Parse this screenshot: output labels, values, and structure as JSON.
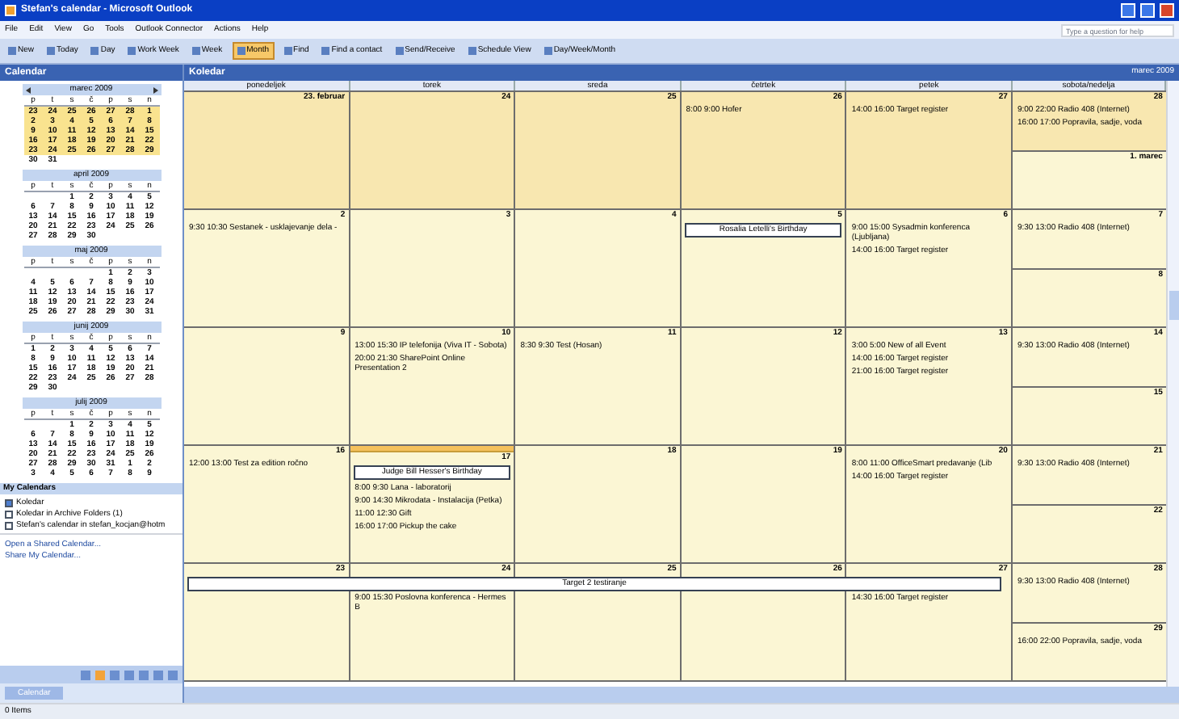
{
  "window": {
    "title": "Stefan's calendar - Microsoft Outlook"
  },
  "menu": [
    "File",
    "Edit",
    "View",
    "Go",
    "Tools",
    "Outlook Connector",
    "Actions",
    "Help"
  ],
  "help_box": {
    "placeholder": "Type a question for help"
  },
  "toolbar": [
    {
      "label": "New",
      "selected": false
    },
    {
      "label": "Today",
      "selected": false
    },
    {
      "label": "Day",
      "selected": false
    },
    {
      "label": "Work Week",
      "selected": false
    },
    {
      "label": "Week",
      "selected": false
    },
    {
      "label": "Month",
      "selected": true
    },
    {
      "label": "Find",
      "selected": false
    },
    {
      "label": "Find a contact",
      "selected": false
    },
    {
      "label": "Send/Receive",
      "selected": false
    },
    {
      "label": "Schedule View",
      "selected": false
    },
    {
      "label": "Day/Week/Month",
      "selected": false
    }
  ],
  "sidebar": {
    "title": "Calendar",
    "months": [
      {
        "name": "marec 2009",
        "nav": true,
        "weekday_letters": [
          "p",
          "t",
          "s",
          "č",
          "p",
          "s",
          "n"
        ],
        "weeks": [
          {
            "days": [
              "23",
              "24",
              "25",
              "26",
              "27",
              "28",
              "1"
            ],
            "selected": true
          },
          {
            "days": [
              "2",
              "3",
              "4",
              "5",
              "6",
              "7",
              "8"
            ],
            "selected": true
          },
          {
            "days": [
              "9",
              "10",
              "11",
              "12",
              "13",
              "14",
              "15"
            ],
            "selected": true
          },
          {
            "days": [
              "16",
              "17",
              "18",
              "19",
              "20",
              "21",
              "22"
            ],
            "selected": true
          },
          {
            "days": [
              "23",
              "24",
              "25",
              "26",
              "27",
              "28",
              "29"
            ],
            "selected": true
          },
          {
            "days": [
              "30",
              "31"
            ],
            "selected": false
          }
        ]
      },
      {
        "name": "april 2009",
        "nav": false,
        "weekday_letters": [
          "p",
          "t",
          "s",
          "č",
          "p",
          "s",
          "n"
        ],
        "weeks": [
          {
            "days": [
              "1",
              "2",
              "3",
              "4",
              "5"
            ],
            "selected": false
          },
          {
            "days": [
              "6",
              "7",
              "8",
              "9",
              "10",
              "11",
              "12"
            ],
            "selected": false
          },
          {
            "days": [
              "13",
              "14",
              "15",
              "16",
              "17",
              "18",
              "19"
            ],
            "selected": false
          },
          {
            "days": [
              "20",
              "21",
              "22",
              "23",
              "24",
              "25",
              "26"
            ],
            "selected": false
          },
          {
            "days": [
              "27",
              "28",
              "29",
              "30"
            ],
            "selected": false
          }
        ]
      },
      {
        "name": "maj 2009",
        "nav": false,
        "weekday_letters": [
          "p",
          "t",
          "s",
          "č",
          "p",
          "s",
          "n"
        ],
        "weeks": [
          {
            "days": [
              "1",
              "2",
              "3"
            ],
            "selected": false
          },
          {
            "days": [
              "4",
              "5",
              "6",
              "7",
              "8",
              "9",
              "10"
            ],
            "selected": false
          },
          {
            "days": [
              "11",
              "12",
              "13",
              "14",
              "15",
              "16",
              "17"
            ],
            "selected": false
          },
          {
            "days": [
              "18",
              "19",
              "20",
              "21",
              "22",
              "23",
              "24"
            ],
            "selected": false
          },
          {
            "days": [
              "25",
              "26",
              "27",
              "28",
              "29",
              "30",
              "31"
            ],
            "selected": false
          }
        ]
      },
      {
        "name": "junij 2009",
        "nav": false,
        "weekday_letters": [
          "p",
          "t",
          "s",
          "č",
          "p",
          "s",
          "n"
        ],
        "weeks": [
          {
            "days": [
              "1",
              "2",
              "3",
              "4",
              "5",
              "6",
              "7"
            ],
            "selected": false
          },
          {
            "days": [
              "8",
              "9",
              "10",
              "11",
              "12",
              "13",
              "14"
            ],
            "selected": false
          },
          {
            "days": [
              "15",
              "16",
              "17",
              "18",
              "19",
              "20",
              "21"
            ],
            "selected": false
          },
          {
            "days": [
              "22",
              "23",
              "24",
              "25",
              "26",
              "27",
              "28"
            ],
            "selected": false
          },
          {
            "days": [
              "29",
              "30"
            ],
            "selected": false
          }
        ]
      },
      {
        "name": "julij 2009",
        "nav": false,
        "weekday_letters": [
          "p",
          "t",
          "s",
          "č",
          "p",
          "s",
          "n"
        ],
        "weeks": [
          {
            "days": [
              "1",
              "2",
              "3",
              "4",
              "5"
            ],
            "selected": false
          },
          {
            "days": [
              "6",
              "7",
              "8",
              "9",
              "10",
              "11",
              "12"
            ],
            "selected": false
          },
          {
            "days": [
              "13",
              "14",
              "15",
              "16",
              "17",
              "18",
              "19"
            ],
            "selected": false
          },
          {
            "days": [
              "20",
              "21",
              "22",
              "23",
              "24",
              "25",
              "26"
            ],
            "selected": false
          },
          {
            "days": [
              "27",
              "28",
              "29",
              "30",
              "31",
              "1",
              "2"
            ],
            "selected": false
          },
          {
            "days": [
              "3",
              "4",
              "5",
              "6",
              "7",
              "8",
              "9"
            ],
            "selected": false
          }
        ]
      }
    ],
    "my_calendars_title": "My Calendars",
    "calendars": [
      {
        "label": "Koledar",
        "checked": true
      },
      {
        "label": "Koledar in Archive Folders (1)",
        "checked": false
      },
      {
        "label": "Stefan's calendar in stefan_kocjan@hotm",
        "checked": false
      }
    ],
    "links": [
      "Open a Shared Calendar...",
      "Share My Calendar..."
    ],
    "view_button": "Calendar"
  },
  "main": {
    "title": "Koledar",
    "range": "marec 2009",
    "columns": [
      "ponedeljek",
      "torek",
      "sreda",
      "četrtek",
      "petek",
      "sobota/nedelja"
    ],
    "weeks": [
      {
        "days": [
          {
            "label": "23. februar",
            "outside": true,
            "selected": false
          },
          {
            "label": "24",
            "outside": true,
            "selected": false
          },
          {
            "label": "25",
            "outside": true,
            "selected": false
          },
          {
            "label": "26",
            "outside": true,
            "selected": false,
            "events": [
              {
                "kind": "timed",
                "text": "8:00 9:00 Hofer"
              }
            ]
          },
          {
            "label": "27",
            "outside": true,
            "selected": false,
            "events": [
              {
                "kind": "timed",
                "text": "14:00 16:00 Target register"
              }
            ]
          },
          {
            "label": "28",
            "outside": true,
            "selected": false,
            "events": [
              {
                "kind": "timed",
                "text": "9:00 22:00 Radio 408 (Internet)"
              },
              {
                "kind": "timed",
                "text": "16:00 17:00 Popravila, sadje, voda"
              }
            ]
          },
          {
            "label": "1. marec",
            "outside": false,
            "selected": false
          }
        ]
      },
      {
        "days": [
          {
            "label": "2",
            "outside": false,
            "selected": false,
            "events": [
              {
                "kind": "timed",
                "text": "9:30 10:30 Sestanek - usklajevanje dela -"
              }
            ]
          },
          {
            "label": "3",
            "outside": false,
            "selected": false
          },
          {
            "label": "4",
            "outside": false,
            "selected": false
          },
          {
            "label": "5",
            "outside": false,
            "selected": false,
            "events": [
              {
                "kind": "allday",
                "text": "Rosalia Letelli's Birthday"
              }
            ]
          },
          {
            "label": "6",
            "outside": false,
            "selected": false,
            "events": [
              {
                "kind": "timed",
                "text": "9:00 15:00 Sysadmin konferenca (Ljubljana)"
              },
              {
                "kind": "timed",
                "text": "14:00 16:00 Target register"
              }
            ]
          },
          {
            "label": "7",
            "outside": false,
            "selected": false,
            "events": [
              {
                "kind": "timed",
                "text": "9:30 13:00 Radio 408 (Internet)"
              }
            ]
          },
          {
            "label": "8",
            "outside": false,
            "selected": false
          }
        ]
      },
      {
        "days": [
          {
            "label": "9",
            "outside": false,
            "selected": false
          },
          {
            "label": "10",
            "outside": false,
            "selected": false,
            "events": [
              {
                "kind": "timed",
                "text": "13:00 15:30 IP telefonija (Viva IT - Sobota)"
              },
              {
                "kind": "timed",
                "text": "20:00 21:30 SharePoint Online Presentation 2"
              }
            ]
          },
          {
            "label": "11",
            "outside": false,
            "selected": false,
            "events": [
              {
                "kind": "timed",
                "text": "8:30 9:30 Test (Hosan)"
              }
            ]
          },
          {
            "label": "12",
            "outside": false,
            "selected": false
          },
          {
            "label": "13",
            "outside": false,
            "selected": false,
            "events": [
              {
                "kind": "timed",
                "text": "3:00 5:00 New of all Event"
              },
              {
                "kind": "timed",
                "text": "14:00 16:00 Target register"
              },
              {
                "kind": "timed",
                "text": "21:00 16:00 Target register"
              }
            ]
          },
          {
            "label": "14",
            "outside": false,
            "selected": false,
            "events": [
              {
                "kind": "timed",
                "text": "9:30 13:00 Radio 408 (Internet)"
              }
            ]
          },
          {
            "label": "15",
            "outside": false,
            "selected": false
          }
        ]
      },
      {
        "days": [
          {
            "label": "16",
            "outside": false,
            "selected": false,
            "events": [
              {
                "kind": "timed",
                "text": "12:00 13:00 Test za edition ročno"
              }
            ]
          },
          {
            "label": "17",
            "outside": false,
            "selected": true,
            "events": [
              {
                "kind": "allday",
                "text": "Judge Bill Hesser's Birthday"
              },
              {
                "kind": "timed",
                "text": "8:00 9:30 Lana - laboratorij"
              },
              {
                "kind": "timed",
                "text": "9:00 14:30 Mikrodata - Instalacija (Petka)"
              },
              {
                "kind": "timed",
                "text": "11:00 12:30 Gift"
              },
              {
                "kind": "timed",
                "text": "16:00 17:00 Pickup the cake"
              }
            ]
          },
          {
            "label": "18",
            "outside": false,
            "selected": false
          },
          {
            "label": "19",
            "outside": false,
            "selected": false
          },
          {
            "label": "20",
            "outside": false,
            "selected": false,
            "events": [
              {
                "kind": "timed",
                "text": "8:00 11:00 OfficeSmart predavanje (Lib"
              },
              {
                "kind": "timed",
                "text": "14:00 16:00 Target register"
              }
            ]
          },
          {
            "label": "21",
            "outside": false,
            "selected": false,
            "events": [
              {
                "kind": "timed",
                "text": "9:30 13:00 Radio 408 (Internet)"
              }
            ]
          },
          {
            "label": "22",
            "outside": false,
            "selected": false
          }
        ]
      },
      {
        "banner": "Target 2 testiranje",
        "days": [
          {
            "label": "23",
            "outside": false,
            "selected": false
          },
          {
            "label": "24",
            "outside": false,
            "selected": false,
            "events": [
              {
                "kind": "timed",
                "text": "9:00 15:30 Poslovna konferenca - Hermes B"
              }
            ]
          },
          {
            "label": "25",
            "outside": false,
            "selected": false
          },
          {
            "label": "26",
            "outside": false,
            "selected": false
          },
          {
            "label": "27",
            "outside": false,
            "selected": false,
            "events": [
              {
                "kind": "timed",
                "text": "14:30 16:00 Target register"
              }
            ]
          },
          {
            "label": "28",
            "outside": false,
            "selected": false,
            "events": [
              {
                "kind": "timed",
                "text": "9:30 13:00 Radio 408 (Internet)"
              }
            ]
          },
          {
            "label": "29",
            "outside": false,
            "selected": false,
            "events": [
              {
                "kind": "timed",
                "text": "16:00 22:00 Popravila, sadje, voda"
              }
            ]
          }
        ]
      }
    ]
  },
  "status_bar": "0 Items"
}
